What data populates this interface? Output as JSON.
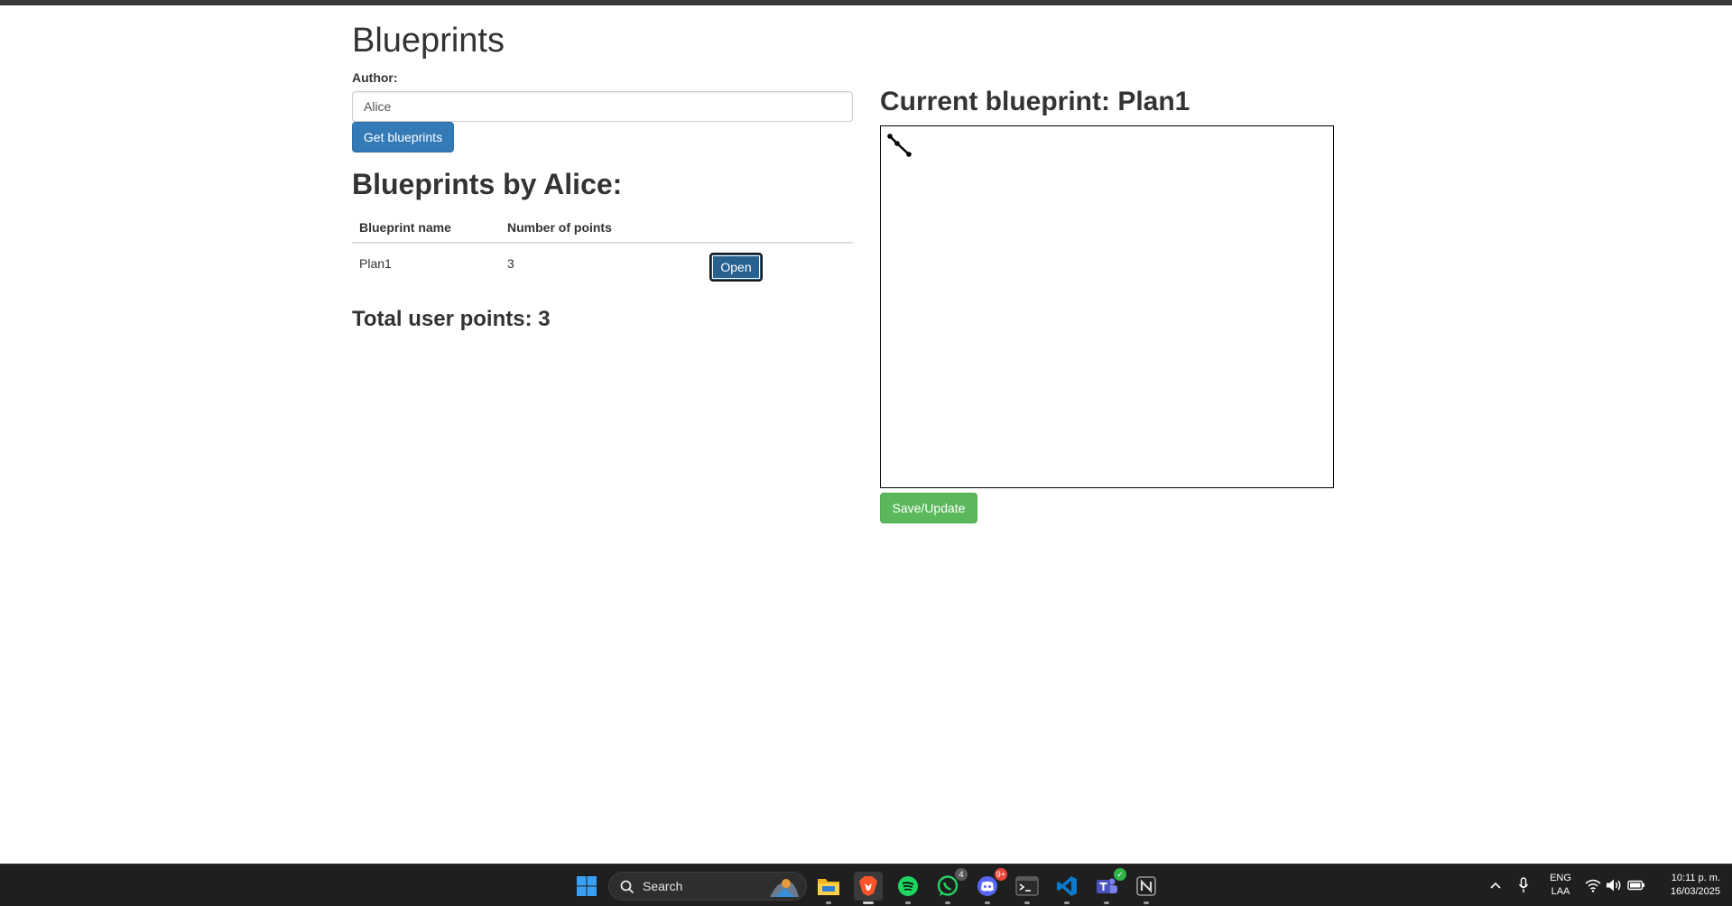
{
  "page": {
    "title": "Blueprints",
    "author_label": "Author:",
    "author_value": "Alice",
    "get_button": "Get blueprints",
    "list_title": "Blueprints by Alice:",
    "table": {
      "headers": [
        "Blueprint name",
        "Number of points",
        ""
      ],
      "rows": [
        {
          "name": "Plan1",
          "points": "3",
          "action": "Open"
        }
      ]
    },
    "total_points": "Total user points: 3",
    "current_title": "Current blueprint: Plan1",
    "save_button": "Save/Update"
  },
  "taskbar": {
    "search_label": "Search",
    "whatsapp_badge": "4",
    "discord_badge": "9+",
    "language": "ENG",
    "layout": "LAA",
    "time": "10:11 p. m.",
    "date": "16/03/2025"
  },
  "colors": {
    "primary_button": "#337ab7",
    "open_button": "#286090",
    "success_button": "#5cb85c",
    "taskbar": "#1f1f1f"
  }
}
